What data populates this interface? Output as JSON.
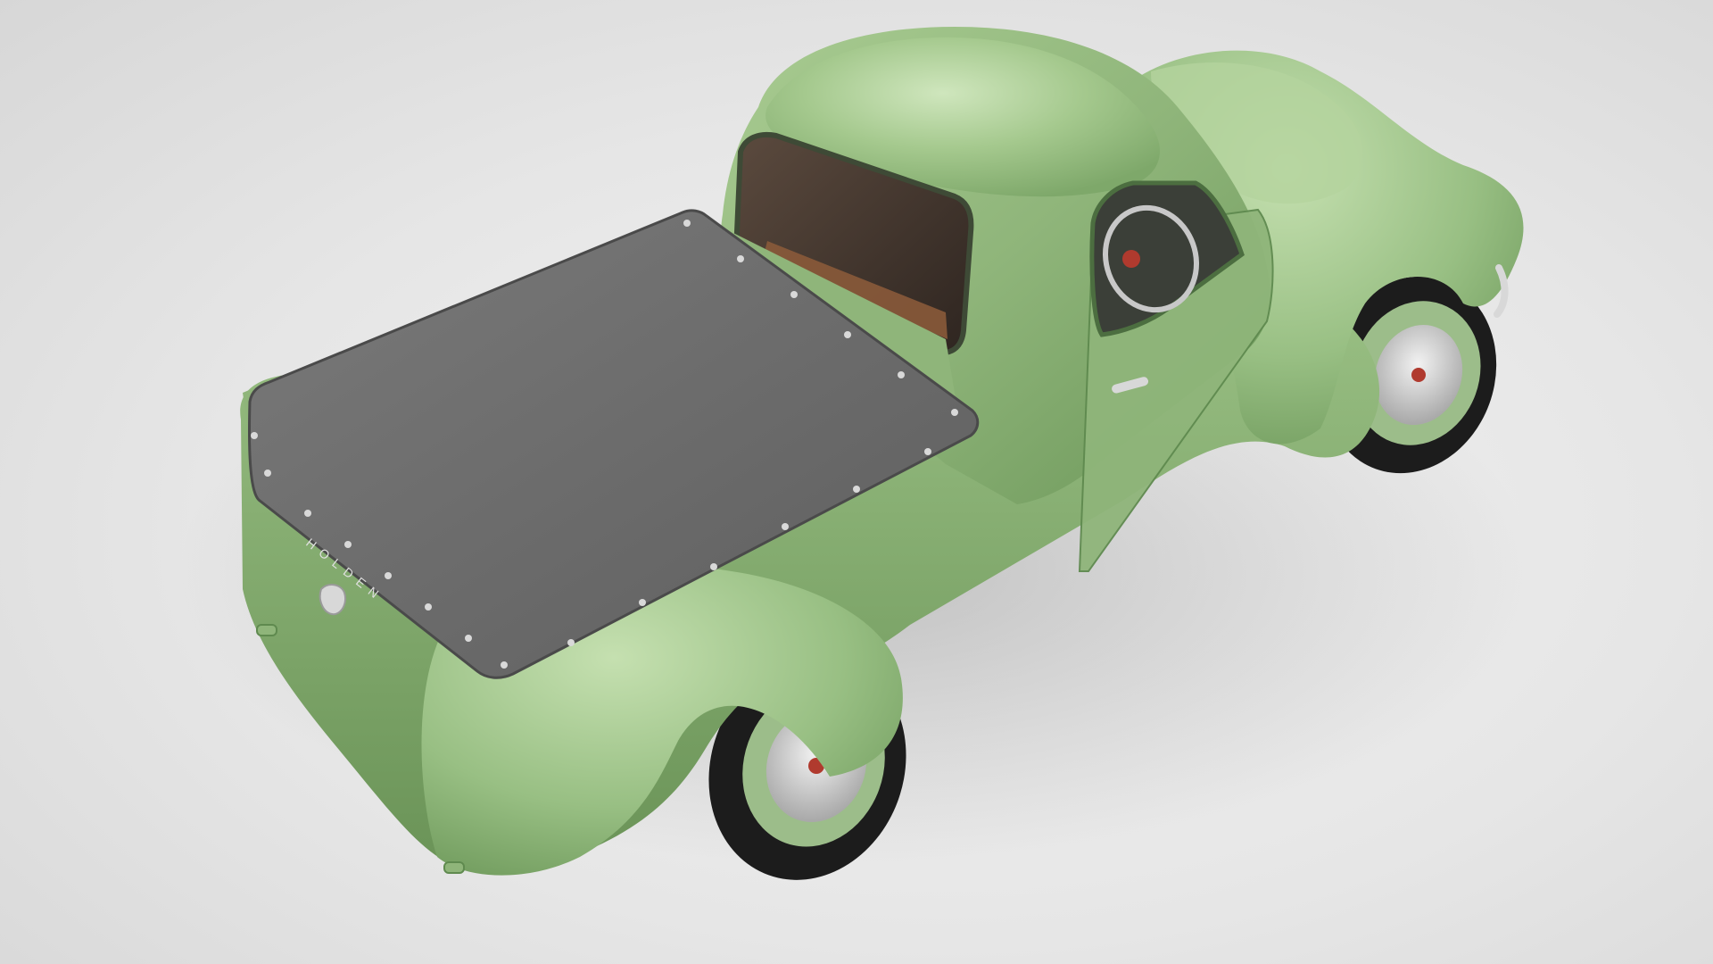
{
  "scene": {
    "subject": "",
    "badge_text": "HOLDEN",
    "colors": {
      "background": "#e4e4e4",
      "body_green": "#8fb57a",
      "body_green_light": "#b8d6a2",
      "body_green_dark": "#5f8a4f",
      "tonneau_cover": "#6e6e6e",
      "tire": "#1c1c1c",
      "interior_brown": "#8a5a3a",
      "chrome": "#d8d8d8"
    }
  }
}
